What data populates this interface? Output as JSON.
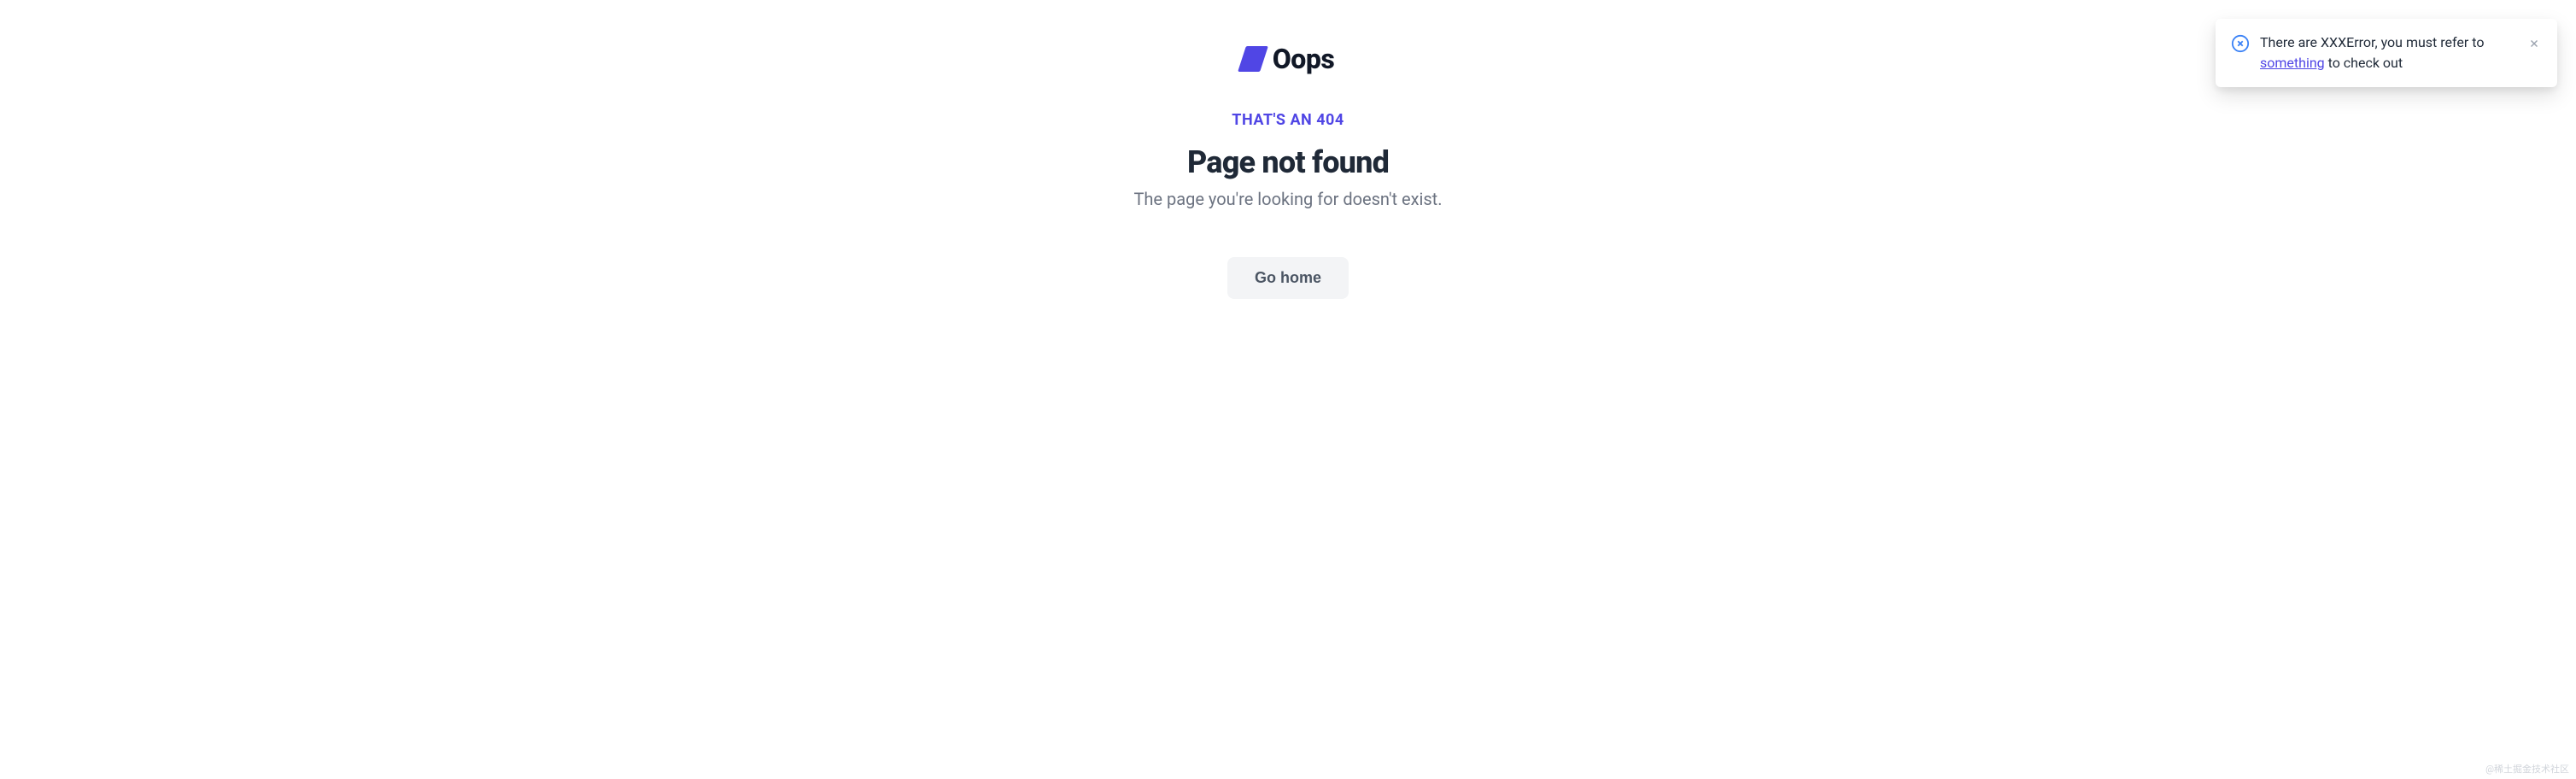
{
  "brand": {
    "name": "Oops"
  },
  "error": {
    "code_label": "THAT'S AN 404",
    "title": "Page not found",
    "subtitle": "The page you're looking for doesn't exist.",
    "button_label": "Go home"
  },
  "notification": {
    "text_before": "There are XXXError, you must refer to ",
    "link_text": "something",
    "text_after": " to check out"
  },
  "watermark": "@稀土掘金技术社区"
}
